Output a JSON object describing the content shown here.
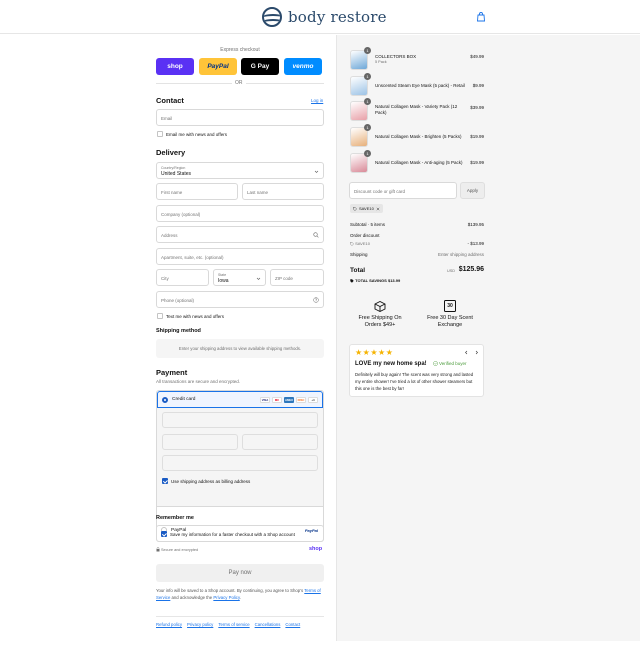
{
  "header": {
    "brand": "body restore"
  },
  "express": {
    "label": "Express checkout",
    "shop_pay": "shop",
    "paypal": "PayPal",
    "gpay": "G Pay",
    "venmo": "venmo",
    "or": "OR"
  },
  "contact": {
    "title": "Contact",
    "login": "Log in",
    "email_placeholder": "Email",
    "news_label": "Email me with news and offers"
  },
  "delivery": {
    "title": "Delivery",
    "country_label": "Country/Region",
    "country_value": "United States",
    "first_name": "First name",
    "last_name": "Last name",
    "company": "Company (optional)",
    "address": "Address",
    "apartment": "Apartment, suite, etc. (optional)",
    "city": "City",
    "state_label": "State",
    "state_value": "Iowa",
    "zip": "ZIP code",
    "phone": "Phone (optional)",
    "text_label": "Text me with news and offers"
  },
  "shipping_method": {
    "title": "Shipping method",
    "note": "Enter your shipping address to view available shipping methods."
  },
  "payment": {
    "title": "Payment",
    "subtitle": "All transactions are secure and encrypted.",
    "credit_card": "Credit card",
    "cards": [
      "VISA",
      "MC",
      "AMEX",
      "DISC"
    ],
    "more_cards": "+4",
    "billing_label": "Use shipping address as billing address",
    "paypal": "PayPal",
    "paypal_logo": "PayPal"
  },
  "remember": {
    "title": "Remember me",
    "save_label": "Save my information for a faster checkout with a Shop account",
    "secure": "Secure and encrypted",
    "shop": "shop"
  },
  "pay_now": "Pay now",
  "fine_print": {
    "text": "Your info will be saved to a Shop account. By continuing, you agree to Shop’s",
    "terms": "Terms of Service",
    "and": " and acknowledge the ",
    "privacy": "Privacy Policy",
    "end": "."
  },
  "footer": [
    "Refund policy",
    "Privacy policy",
    "Terms of service",
    "Cancellations",
    "Contact"
  ],
  "order": {
    "items": [
      {
        "name": "COLLECTORS BOX",
        "variant": "5 Pack",
        "price": "$49.99",
        "qty": "1",
        "color": "#6ea8d8"
      },
      {
        "name": "Unscented Steam Eye Mask (5 pack) - Retail",
        "variant": "",
        "price": "$9.99",
        "qty": "1",
        "color": "#9cc3e6"
      },
      {
        "name": "Natural Collagen Mask - Variety Pack (12 Pack)",
        "variant": "",
        "price": "$39.99",
        "qty": "1",
        "color": "#e8a0a8"
      },
      {
        "name": "Natural Collagen Mask - Brighten (5 Packs)",
        "variant": "",
        "price": "$19.99",
        "qty": "1",
        "color": "#e7b07a"
      },
      {
        "name": "Natural Collagen Mask - Anti-aging (5 Pack)",
        "variant": "",
        "price": "$19.99",
        "qty": "1",
        "color": "#d98a98"
      }
    ],
    "discount_placeholder": "Discount code or gift card",
    "apply": "Apply",
    "code": "SAVE10",
    "subtotal_label": "Subtotal · 5 items",
    "subtotal": "$139.95",
    "order_discount": "Order discount",
    "discount_code": "SAVE10",
    "discount_value": "- $13.99",
    "shipping_label": "Shipping",
    "shipping_value": "Enter shipping address",
    "total_label": "Total",
    "currency": "USD",
    "total": "$125.96",
    "savings_label": "TOTAL SAVINGS",
    "savings": "$13.99"
  },
  "perks": [
    {
      "text": "Free Shipping On Orders $49+"
    },
    {
      "text": "Free 30 Day Scent Exchange",
      "icon_label": "30"
    }
  ],
  "review": {
    "stars": "★★★★★",
    "title": "LOVE my new home spa!",
    "verified": "Verified buyer",
    "body": "Definitely will buy again! The scent was very strong and lasted my entire shower! I've tried a lot of other shower steamers but this one is the best by far!",
    "star_color": "#f5b301"
  }
}
